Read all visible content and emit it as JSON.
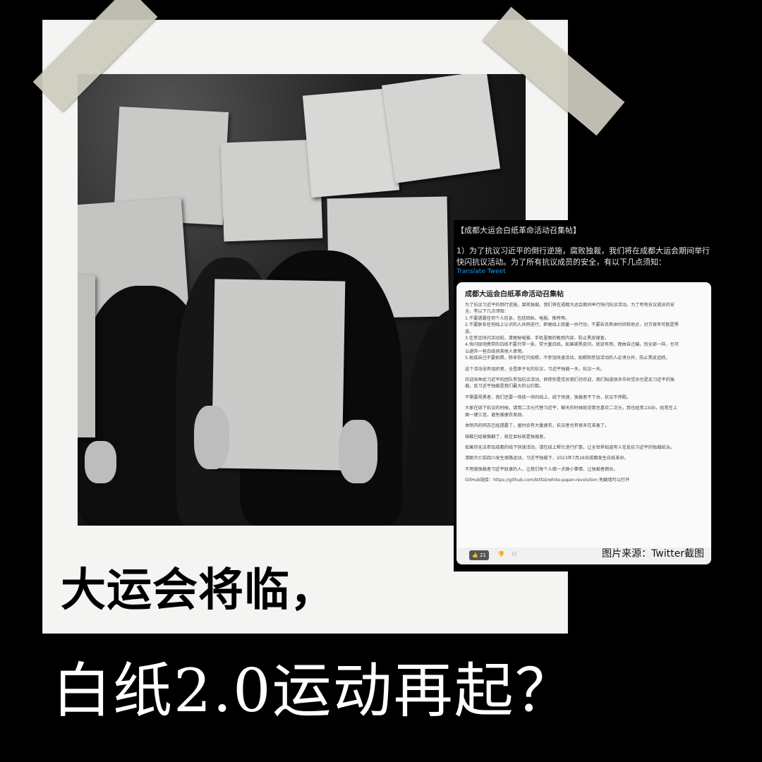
{
  "screenshot": {
    "title": "【成都大运会白纸革命活动召集帖】",
    "body": "1）为了抗议习近平的倒行逆施，腐败独裁，我们将在成都大运会期间举行快闪抗议活动。为了所有抗议成员的安全，有以下几点须知：",
    "translate_label": "Translate Tweet",
    "card": {
      "title": "成都大运会白纸革命活动召集帖",
      "paragraphs": [
        [
          "为了抗议习近平的倒行逆施，腐败独裁，我们将在成都大运会期间举行快闪抗议活动。为了所有抗议成员的安",
          "全，有以下几点须知："
        ],
        [
          "1.不要透露任何个人信息，包括回贴、电报、推特等。"
        ],
        [
          "2.不要联系任何线上认识的人共同进行，即便线上商量一共行动，不要告诉具体时间和地点，对方很有可能是黑",
          "皮。"
        ],
        [
          "3.在参见快闪活动前，清理掉电脑、手机里面的敏感内容，防止黑皮搜查。"
        ],
        [
          "4.快闪现场携带的白纸不要只带一张，带大量白纸，如果被黑皮问，就说有用，理由自己编，别全部一样，也可",
          "以递弃一些白纸供其他人使用。"
        ],
        [
          "5.现成自己不要拍照，除非你在只拍照，不参加快速活动，拍照和参加活动的人必须分开，防止黑皮追踪。"
        ],
        [
          "这个活动没有组织者，全是原子化的抗议，习近平独裁一天，抗议一天。"
        ],
        [
          "欢迎各种反习近平的团队参加抗议活动，即使你是党员我们也欢迎，我们知道很多中共党员也是反习近平的独",
          "裁，反习近平独裁是我们最大的公约数。"
        ],
        [
          "不需要视勇者，我们还要一场接一场的线上、线下快速，独裁者不下台，抗议不停歇。"
        ],
        [
          "大家在线下抗议的时候，请用二次元代替习近平，聊天的时候就说我也喜欢二次元，我也经常上b站，经常在上",
          "面一键三连，避免被便衣发现。"
        ],
        [
          "体制内的同志已经透露了，届时会有大量便衣，抗议者也有很多在准备了。"
        ],
        [
          "核酸已经被推翻了，现在目标就是独裁者。"
        ],
        [
          "如果你无法参加成都的线下快速活动，请在线上帮忙进行扩散，让全世界知道有人在反抗习近平的独裁统治。"
        ],
        [
          "清朝灭亡前四川发生保路运动，习近平独裁下，2023年7月28日成都发生白纸革命。"
        ],
        [
          "不用做独裁者习近平奴隶的人，让我们每个人做一点微小事情，让独裁者倒台。"
        ],
        [
          "GitHub链接：https://github.com/bitfat/white-paper-revolution  免翻墙可以打开"
        ]
      ],
      "like_count": "21"
    },
    "source_label": "图片来源：Twitter截图"
  },
  "headline": {
    "line1": "大运会将临，",
    "line2": "白纸2.0运动再起？"
  }
}
